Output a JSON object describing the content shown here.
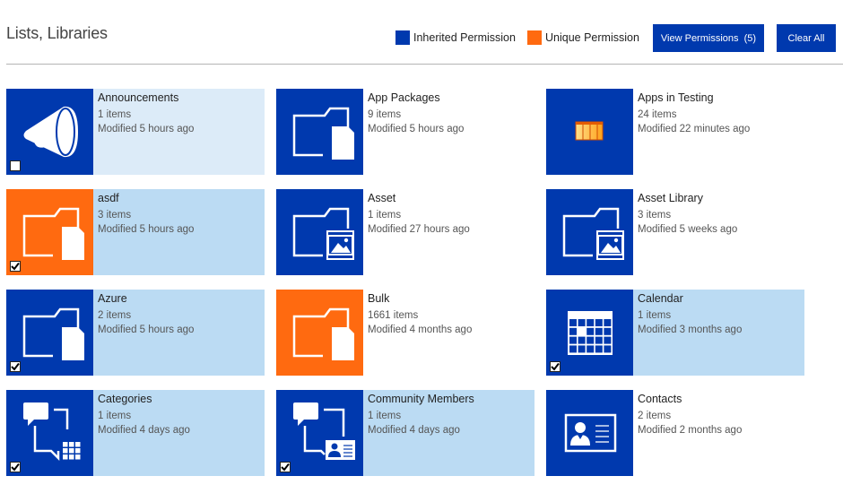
{
  "header": {
    "title": "Lists, Libraries",
    "legend": [
      {
        "label": "Inherited Permission",
        "color": "#0039ae"
      },
      {
        "label": "Unique Permission",
        "color": "#ff6a10"
      }
    ],
    "view_permissions_label": "View Permissions  (5)",
    "clear_all_label": "Clear All"
  },
  "colors": {
    "inherited": "#0039ae",
    "unique": "#ff6a10",
    "selected_bg": "#bbdbf3",
    "hover_bg": "#dcebf8"
  },
  "tiles": [
    {
      "name": "Announcements",
      "count": "1 items",
      "modified": "Modified 5 hours ago",
      "icon": "megaphone-icon",
      "permission": "inherited",
      "state": "hover",
      "checkbox": "unchecked"
    },
    {
      "name": "App Packages",
      "count": "9 items",
      "modified": "Modified 5 hours ago",
      "icon": "folder-document-icon",
      "permission": "inherited",
      "state": "normal",
      "checkbox": "none"
    },
    {
      "name": "Apps in Testing",
      "count": "24 items",
      "modified": "Modified 22 minutes ago",
      "icon": "table-list-icon",
      "permission": "inherited",
      "state": "normal",
      "checkbox": "none"
    },
    {
      "name": "asdf",
      "count": "3 items",
      "modified": "Modified 5 hours ago",
      "icon": "folder-document-icon",
      "permission": "unique",
      "state": "selected",
      "checkbox": "checked"
    },
    {
      "name": "Asset",
      "count": "1 items",
      "modified": "Modified 27 hours ago",
      "icon": "folder-image-icon",
      "permission": "inherited",
      "state": "normal",
      "checkbox": "none"
    },
    {
      "name": "Asset Library",
      "count": "3 items",
      "modified": "Modified 5 weeks ago",
      "icon": "folder-image-icon",
      "permission": "inherited",
      "state": "normal",
      "checkbox": "none"
    },
    {
      "name": "Azure",
      "count": "2 items",
      "modified": "Modified 5 hours ago",
      "icon": "folder-document-icon",
      "permission": "inherited",
      "state": "selected",
      "checkbox": "checked"
    },
    {
      "name": "Bulk",
      "count": "1661 items",
      "modified": "Modified 4 months ago",
      "icon": "folder-document-icon",
      "permission": "unique",
      "state": "normal",
      "checkbox": "none"
    },
    {
      "name": "Calendar",
      "count": "1 items",
      "modified": "Modified 3 months ago",
      "icon": "calendar-icon",
      "permission": "inherited",
      "state": "selected",
      "checkbox": "checked"
    },
    {
      "name": "Categories",
      "count": "1 items",
      "modified": "Modified 4 days ago",
      "icon": "discussion-grid-icon",
      "permission": "inherited",
      "state": "selected",
      "checkbox": "checked"
    },
    {
      "name": "Community Members",
      "count": "1 items",
      "modified": "Modified 4 days ago",
      "icon": "discussion-contact-icon",
      "permission": "inherited",
      "state": "selected",
      "checkbox": "checked"
    },
    {
      "name": "Contacts",
      "count": "2 items",
      "modified": "Modified 2 months ago",
      "icon": "contact-card-icon",
      "permission": "inherited",
      "state": "normal",
      "checkbox": "none"
    }
  ]
}
